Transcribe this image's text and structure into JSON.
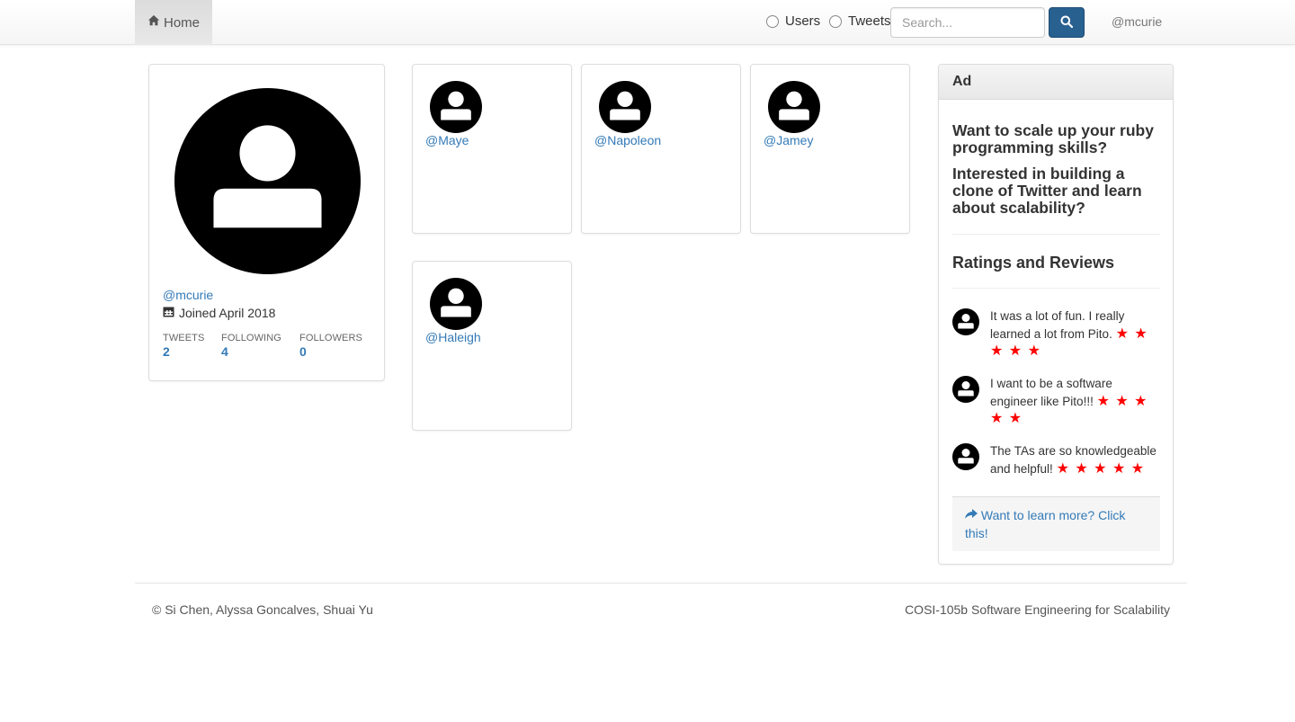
{
  "navbar": {
    "home_label": "Home",
    "search_type_users": "Users",
    "search_type_tweets": "Tweets",
    "search_placeholder": "Search...",
    "current_user": "@mcurie"
  },
  "profile": {
    "handle": "@mcurie",
    "joined": "Joined April 2018",
    "stats": [
      {
        "label": "TWEETS",
        "value": "2"
      },
      {
        "label": "FOLLOWING",
        "value": "4"
      },
      {
        "label": "FOLLOWERS",
        "value": "0"
      }
    ]
  },
  "following": [
    {
      "handle": "@Maye"
    },
    {
      "handle": "@Napoleon"
    },
    {
      "handle": "@Jamey"
    },
    {
      "handle": "@Haleigh"
    }
  ],
  "ad": {
    "heading": "Ad",
    "headline_1": "Want to scale up your ruby programming skills?",
    "headline_2": "Interested in building a clone of Twitter and learn about scalability?",
    "ratings_title": "Ratings and Reviews",
    "reviews": [
      {
        "text": "It was a lot of fun. I really learned a lot from Pito.",
        "stars": "★ ★ ★ ★ ★",
        "rating": 5
      },
      {
        "text": "I want to be a software engineer like Pito!!!",
        "stars": "★ ★ ★ ★ ★",
        "rating": 5
      },
      {
        "text": "The TAs are so knowledgeable and helpful!",
        "stars": "★ ★ ★ ★ ★",
        "rating": 5
      }
    ],
    "cta": "Want to learn more? Click this!"
  },
  "footer": {
    "left": "© Si Chen, Alyssa Goncalves, Shuai Yu",
    "right": "COSI-105b Software Engineering for Scalability"
  },
  "colors": {
    "link": "#337ab7",
    "primary_button": "#286090",
    "star": "#ff0000"
  }
}
